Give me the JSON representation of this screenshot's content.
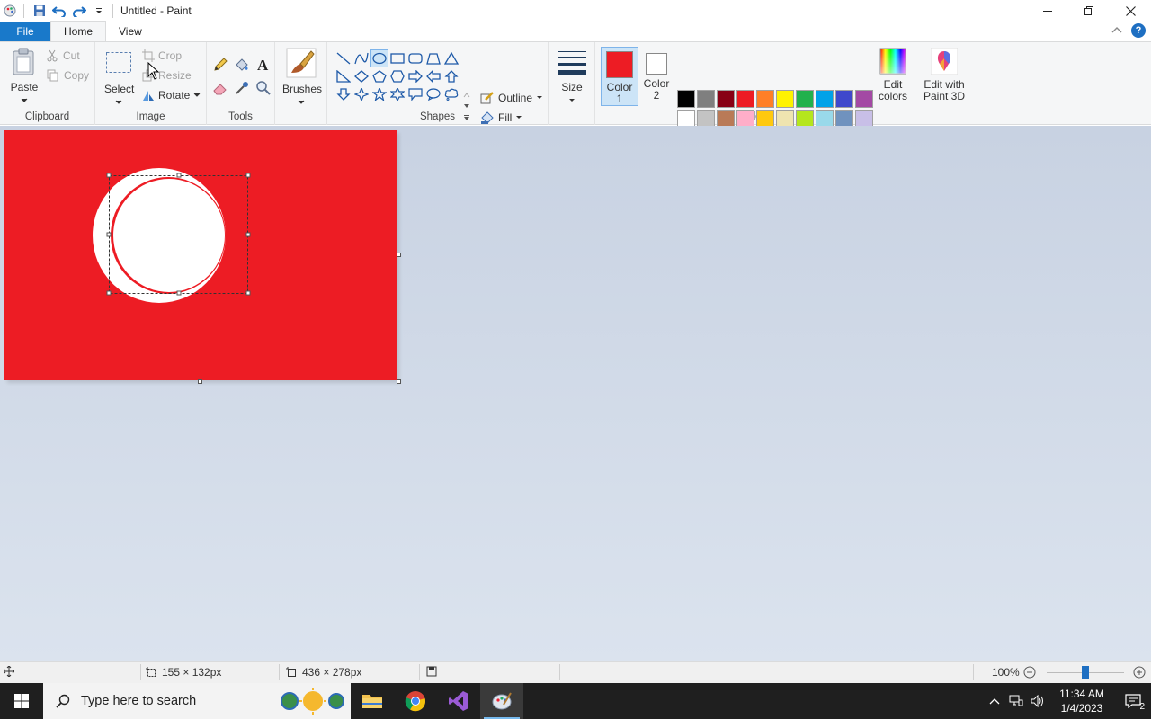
{
  "window": {
    "title": "Untitled - Paint"
  },
  "tabs": [
    {
      "label": "File"
    },
    {
      "label": "Home"
    },
    {
      "label": "View"
    }
  ],
  "clipboard": {
    "paste": "Paste",
    "cut": "Cut",
    "copy": "Copy",
    "group": "Clipboard"
  },
  "image": {
    "select": "Select",
    "crop": "Crop",
    "resize": "Resize",
    "rotate": "Rotate",
    "group": "Image"
  },
  "tools": {
    "group": "Tools"
  },
  "brushes": {
    "label": "Brushes"
  },
  "shapes": {
    "outline": "Outline",
    "fill": "Fill",
    "group": "Shapes"
  },
  "size": {
    "label": "Size"
  },
  "colors": {
    "color1_line1": "Color",
    "color1_line2": "1",
    "color2_line1": "Color",
    "color2_line2": "2",
    "edit_line1": "Edit",
    "edit_line2": "colors",
    "group": "Colors",
    "color1": "#ed1c24",
    "color2": "#ffffff",
    "palette": [
      "#000000",
      "#7f7f7f",
      "#880015",
      "#ed1c24",
      "#ff7f27",
      "#fff200",
      "#22b14c",
      "#00a2e8",
      "#3f48cc",
      "#a349a4",
      "#ffffff",
      "#c3c3c3",
      "#b97a57",
      "#ffaec9",
      "#ffc90e",
      "#efe4b0",
      "#b5e61d",
      "#99d9ea",
      "#7092be",
      "#c8bfe7",
      "#ffffff",
      "#ffffff",
      "#ffffff",
      "#ffffff",
      "#ffffff",
      "#ffffff",
      "#ffffff",
      "#ffffff",
      "#ffffff",
      "#ffffff"
    ]
  },
  "paint3d": {
    "line1": "Edit with",
    "line2": "Paint 3D"
  },
  "status": {
    "selection_size": "155 × 132px",
    "canvas_size": "436 × 278px",
    "zoom": "100%",
    "zoom_slider_position": 0.5
  },
  "taskbar": {
    "search_placeholder": "Type here to search",
    "time": "11:34 AM",
    "date": "1/4/2023",
    "notification_count": "2"
  }
}
